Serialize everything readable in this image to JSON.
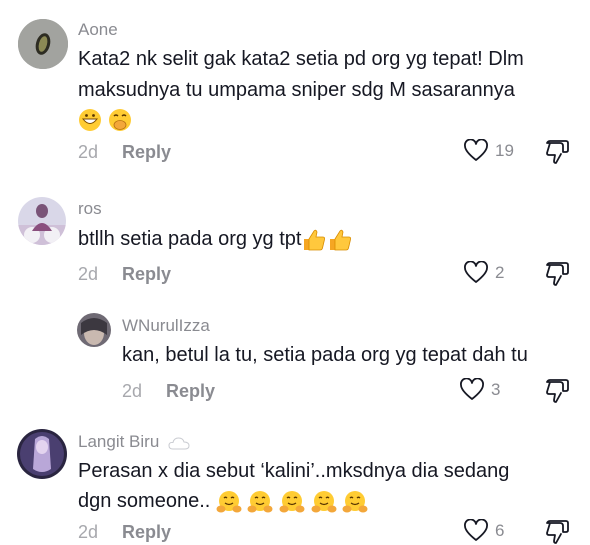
{
  "comments": [
    {
      "username": "Aone",
      "lines": [
        "Kata2 nk selit gak kata2 setia pd org yg tepat! Dlm",
        "maksudnya tu umpama sniper sdg M sasarannya"
      ],
      "emojis": [
        "grinning-face-emoji",
        "face-with-hand-over-mouth-emoji"
      ],
      "time": "2d",
      "reply_label": "Reply",
      "likes": "19"
    },
    {
      "username": "ros",
      "lines": [
        "btllh setia pada org yg tpt"
      ],
      "emojis": [
        "thumbs-up-emoji",
        "thumbs-up-emoji"
      ],
      "time": "2d",
      "reply_label": "Reply",
      "likes": "2"
    },
    {
      "username": "WNurulIzza",
      "lines": [
        "kan, betul la tu, setia pada org yg tepat dah tu"
      ],
      "time": "2d",
      "reply_label": "Reply",
      "likes": "3"
    },
    {
      "username": "Langit Biru",
      "username_icon": "cloud-icon",
      "lines": [
        "Perasan x dia sebut ‘kalini’..mksdnya dia sedang",
        "dgn someone.."
      ],
      "emojis": [
        "hugging-face-emoji",
        "hugging-face-emoji",
        "hugging-face-emoji",
        "hugging-face-emoji",
        "hugging-face-emoji"
      ],
      "time": "2d",
      "reply_label": "Reply",
      "likes": "6"
    }
  ]
}
